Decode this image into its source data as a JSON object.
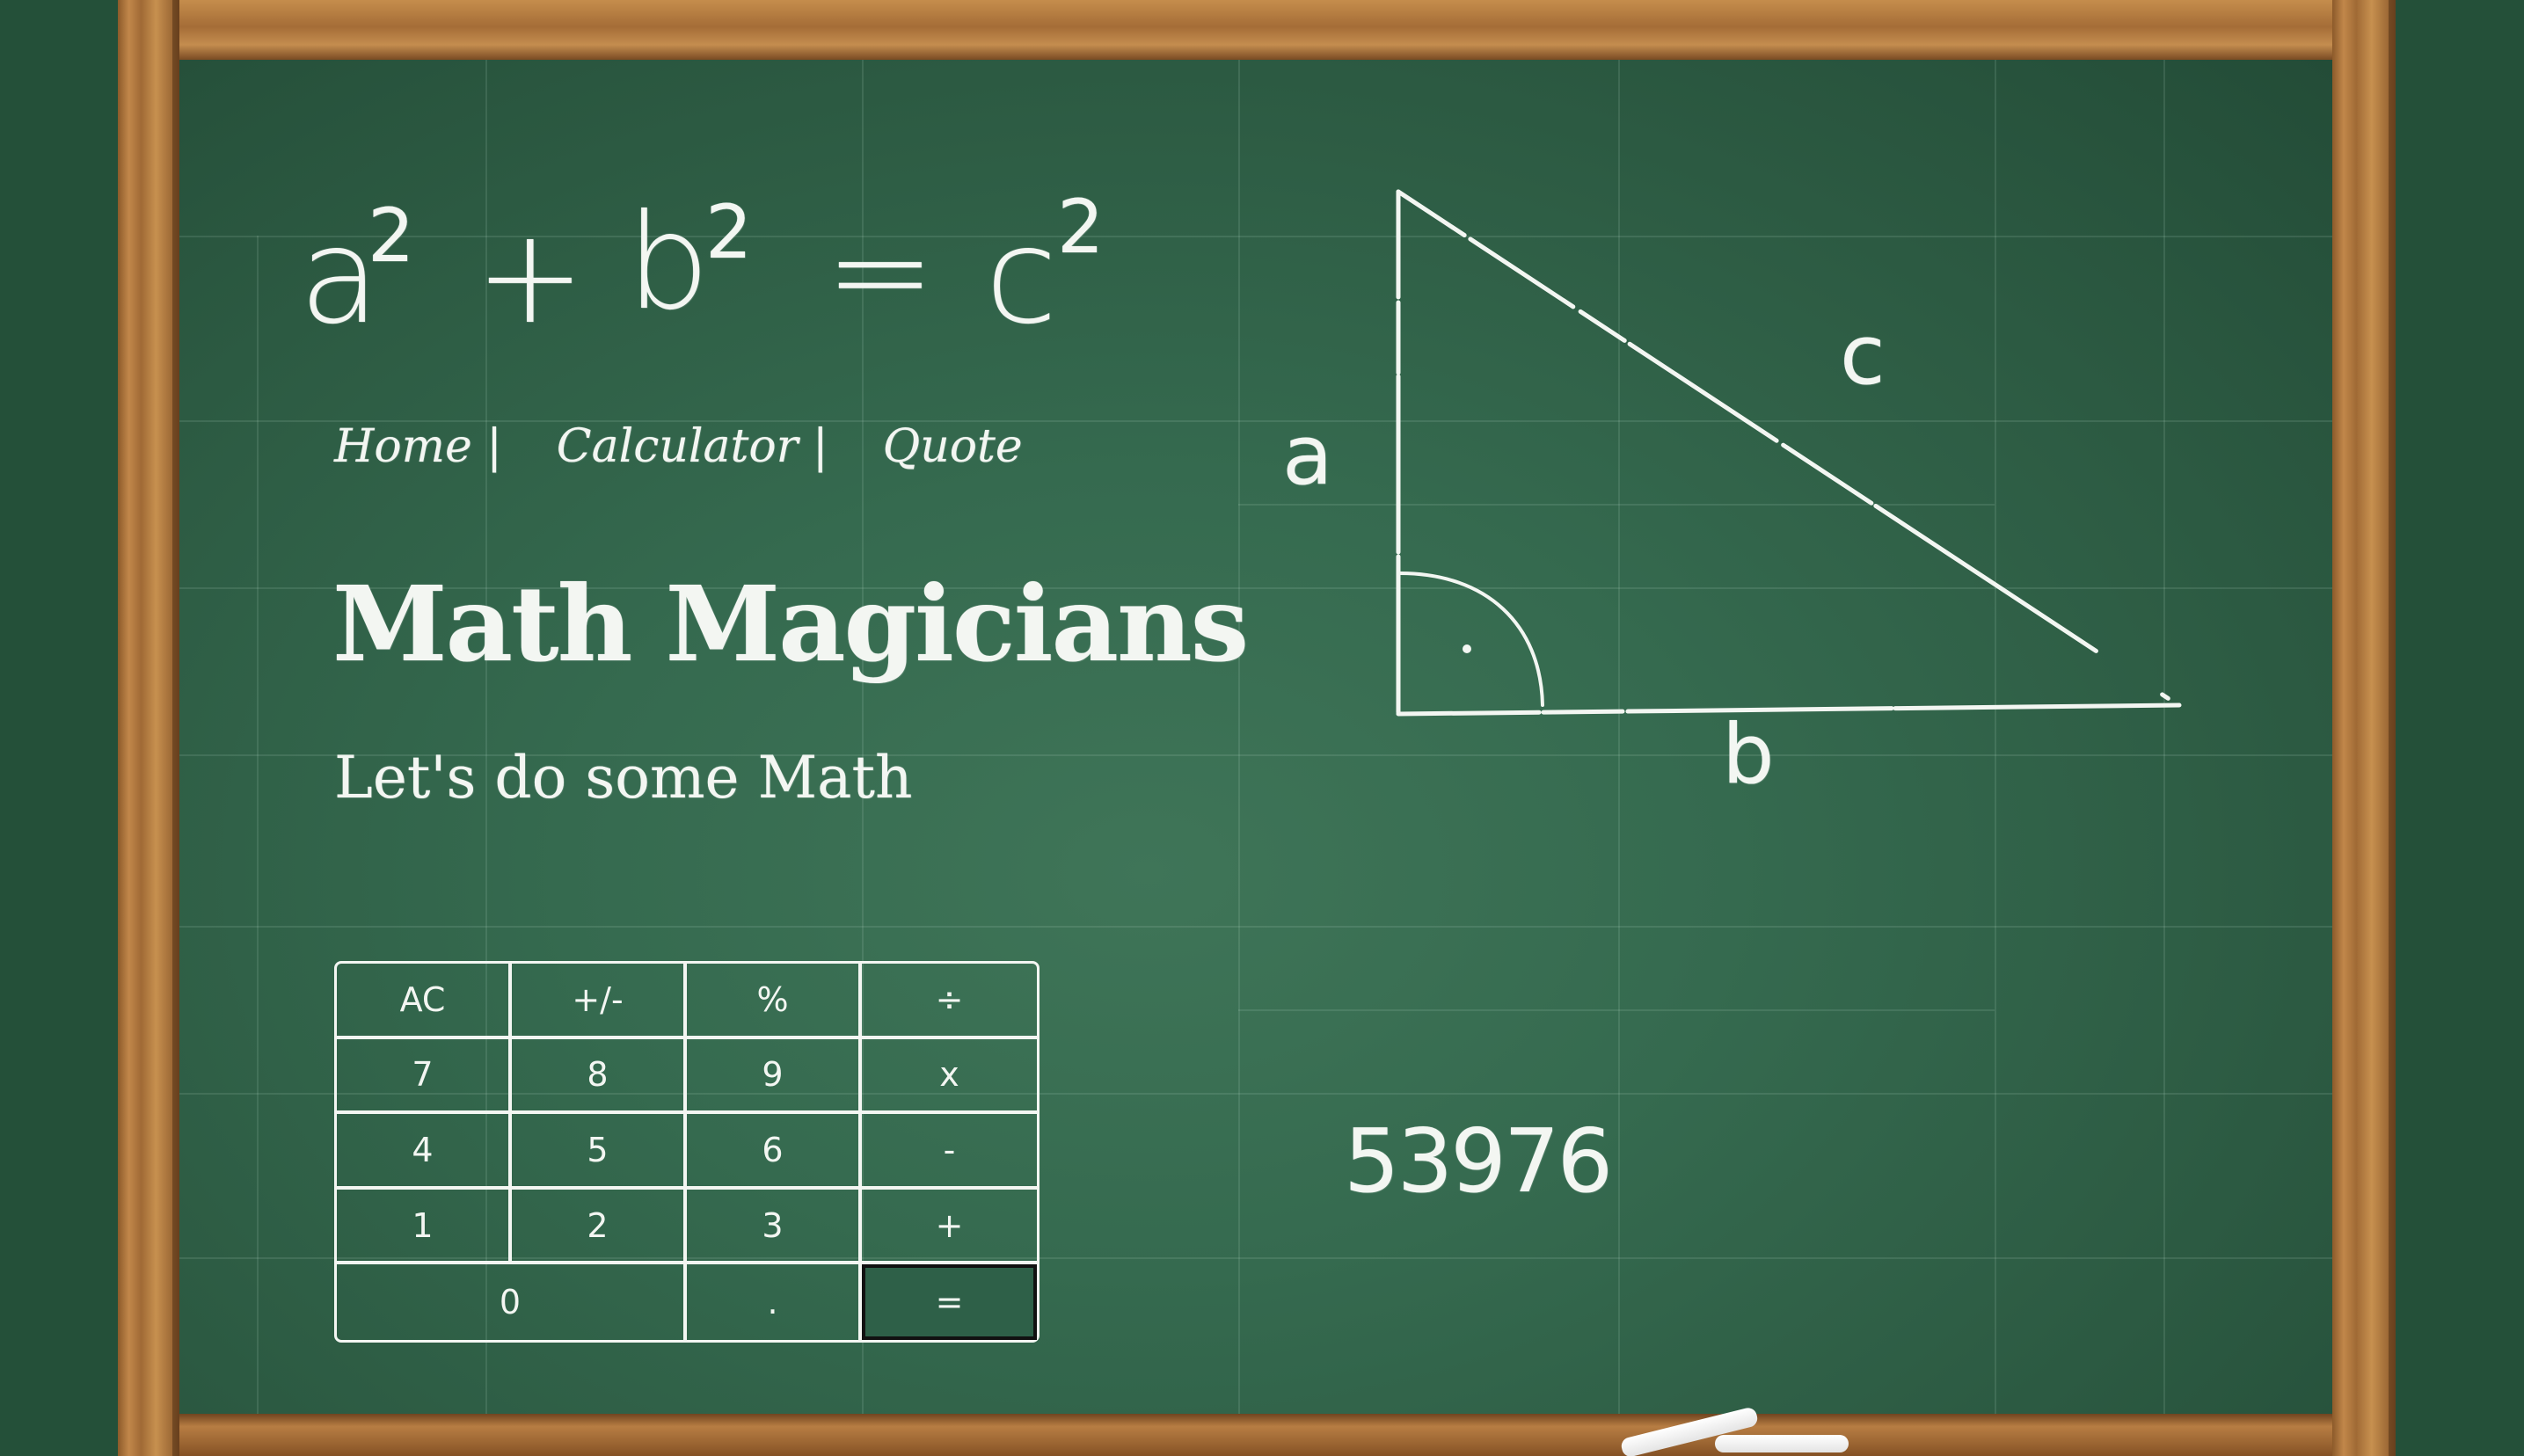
{
  "formula": {
    "a": "a",
    "a_exp": "2",
    "plus": "+",
    "b": "b",
    "b_exp": "2",
    "equals": "=",
    "c": "c",
    "c_exp": "2"
  },
  "nav": {
    "items": [
      {
        "label": "Home |"
      },
      {
        "label": "Calculator |"
      },
      {
        "label": "Quote"
      }
    ]
  },
  "title": "Math Magicians",
  "subtitle": "Let's do some Math",
  "calculator": {
    "keys": [
      "AC",
      "+/-",
      "%",
      "÷",
      "7",
      "8",
      "9",
      "x",
      "4",
      "5",
      "6",
      "-",
      "1",
      "2",
      "3",
      "+",
      "0",
      ".",
      "="
    ]
  },
  "result": "53976",
  "triangle": {
    "label_a": "a",
    "label_b": "b",
    "label_c": "c"
  },
  "colors": {
    "board": "#356a4f",
    "chalk": "#f3f6f2",
    "wood": "#b77d43"
  }
}
